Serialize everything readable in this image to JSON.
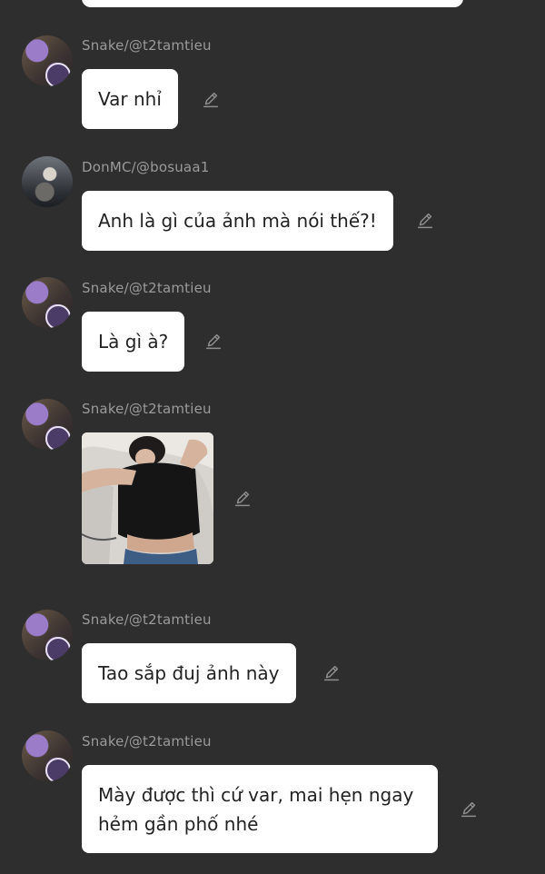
{
  "messages": [
    {
      "user": "Snake/@t2tamtieu",
      "text": "Var nhỉ"
    },
    {
      "user": "DonMC/@bosuaa1",
      "text": "Anh là gì của ảnh mà nói thế?!"
    },
    {
      "user": "Snake/@t2tamtieu",
      "text": "Là gì à?"
    },
    {
      "user": "Snake/@t2tamtieu",
      "image": "photo of person lying in black t-shirt"
    },
    {
      "user": "Snake/@t2tamtieu",
      "text": "Tao sắp đuj ảnh này"
    },
    {
      "user": "Snake/@t2tamtieu",
      "text_line1": "Mày được thì cứ var, mai hẹn ngay",
      "text_line2": "hẻm gần phố nhé"
    }
  ],
  "icons": {
    "edit": "pencil-edit-icon"
  },
  "colors": {
    "background": "#2e2e2e",
    "bubble": "#ffffff",
    "username": "#9a9a9a"
  }
}
